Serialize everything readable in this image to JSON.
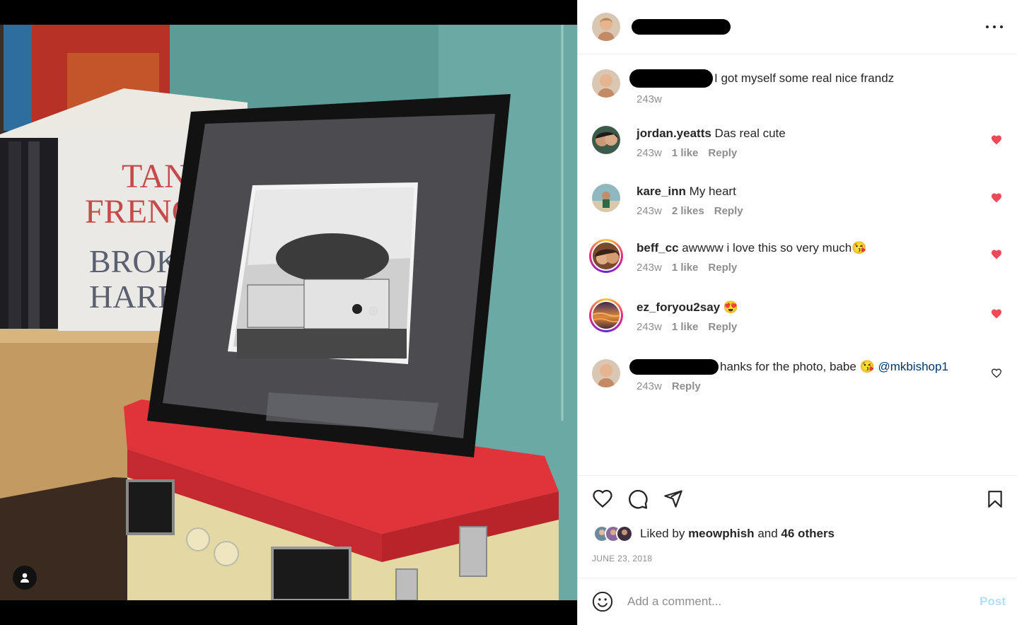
{
  "post": {
    "caption": {
      "text": "I got myself some real nice frandz",
      "time": "243w"
    },
    "more_icon": "more-horizontal-icon",
    "photo_book_text": [
      "TANA",
      "FRENC",
      "BROKE",
      "HARBO"
    ]
  },
  "comments": [
    {
      "username": "jordan.yeatts",
      "text": "Das real cute",
      "time": "243w",
      "likes": "1 like",
      "reply": "Reply",
      "liked": true,
      "ring": false
    },
    {
      "username": "kare_inn",
      "text": "My heart",
      "time": "243w",
      "likes": "2 likes",
      "reply": "Reply",
      "liked": true,
      "ring": false
    },
    {
      "username": "beff_cc",
      "text": "awwww i love this so very much😘",
      "time": "243w",
      "likes": "1 like",
      "reply": "Reply",
      "liked": true,
      "ring": true
    },
    {
      "username": "ez_foryou2say",
      "text": "😍",
      "time": "243w",
      "likes": "1 like",
      "reply": "Reply",
      "liked": true,
      "ring": true
    },
    {
      "text": "hanks for the photo, babe 😘",
      "mention": "@mkbishop1",
      "time": "243w",
      "reply": "Reply",
      "liked": false,
      "ring": false
    }
  ],
  "actions": {
    "icons": [
      "heart-icon",
      "comment-icon",
      "share-icon",
      "bookmark-icon"
    ],
    "liked_by_prefix": "Liked by",
    "liked_by_user": "meowphish",
    "liked_by_and": "and",
    "liked_by_others": "46 others",
    "date": "JUNE 23, 2018"
  },
  "add_comment": {
    "placeholder": "Add a comment...",
    "post_label": "Post"
  },
  "colors": {
    "heart_red": "#ed4956",
    "post_disabled": "#b2dffc",
    "mention": "#00376b",
    "meta_gray": "#8e8e8e"
  }
}
